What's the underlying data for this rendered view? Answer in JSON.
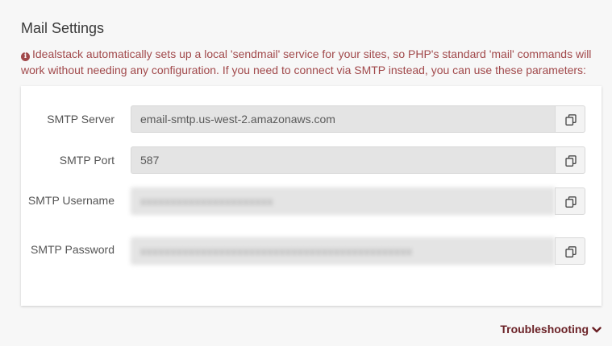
{
  "section": {
    "title": "Mail Settings",
    "notice_icon": "info-circle-icon",
    "notice": "Idealstack automatically sets up a local 'sendmail' service for your sites, so PHP's standard 'mail' commands will work without needing any configuration. If you need to connect via SMTP instead, you can use these parameters:"
  },
  "fields": [
    {
      "label": "SMTP Server",
      "value": "email-smtp.us-west-2.amazonaws.com",
      "masked": false,
      "copy_icon": "copy-icon"
    },
    {
      "label": "SMTP Port",
      "value": "587",
      "masked": false,
      "copy_icon": "copy-icon"
    },
    {
      "label": "SMTP Username",
      "value": "",
      "masked": true,
      "copy_icon": "copy-icon"
    },
    {
      "label": "SMTP Password",
      "value": "",
      "masked": true,
      "copy_icon": "copy-icon"
    }
  ],
  "footer": {
    "troubleshooting_label": "Troubleshooting",
    "icon": "chevron-down-icon"
  },
  "colors": {
    "notice_text": "#a1494b",
    "link": "#6b2227",
    "field_bg": "#e4e4e4"
  }
}
